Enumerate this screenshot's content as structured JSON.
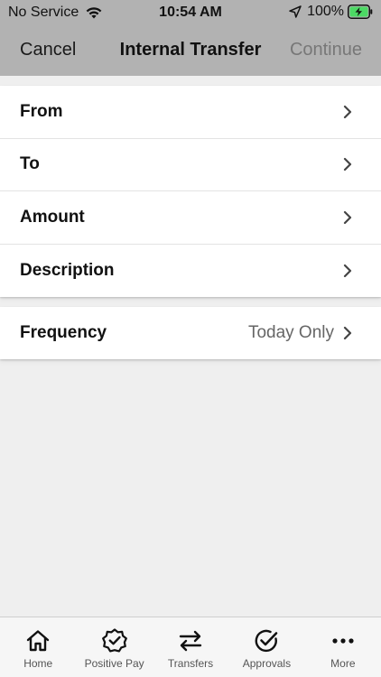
{
  "status": {
    "carrier": "No Service",
    "time": "10:54 AM",
    "battery": "100%"
  },
  "nav": {
    "cancel": "Cancel",
    "title": "Internal Transfer",
    "continue": "Continue"
  },
  "form": {
    "rows": [
      {
        "label": "From"
      },
      {
        "label": "To"
      },
      {
        "label": "Amount"
      },
      {
        "label": "Description"
      }
    ],
    "frequency": {
      "label": "Frequency",
      "value": "Today Only"
    }
  },
  "tabs": [
    {
      "label": "Home",
      "icon": "home-icon"
    },
    {
      "label": "Positive Pay",
      "icon": "badge-check-icon"
    },
    {
      "label": "Transfers",
      "icon": "transfer-arrows-icon",
      "active": true
    },
    {
      "label": "Approvals",
      "icon": "check-circle-icon"
    },
    {
      "label": "More",
      "icon": "more-dots-icon"
    }
  ],
  "colors": {
    "navbar": "#b2b2b2",
    "background": "#efefef",
    "battery_fill": "#4cd964"
  }
}
